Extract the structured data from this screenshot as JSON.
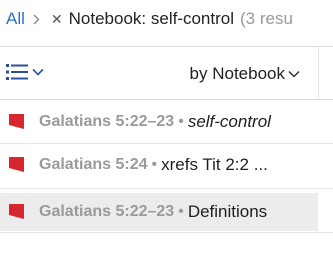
{
  "breadcrumb": {
    "all_label": "All",
    "notebook_title": "Notebook: self-control",
    "result_count": "(3 resu"
  },
  "toolbar": {
    "sort_label": "by Notebook"
  },
  "items": [
    {
      "reference": "Galatians 5:22–23",
      "separator": "•",
      "text": "self-control"
    },
    {
      "reference": "Galatians 5:24",
      "separator": "•",
      "text": "xrefs Tit 2:2 ..."
    },
    {
      "reference": "Galatians 5:22–23",
      "separator": "•",
      "text": "Definitions"
    }
  ],
  "colors": {
    "accent": "#2a6fd1",
    "flag": "#d7262e",
    "selected_row": "#ececec",
    "muted_text": "#9a9a9a"
  },
  "icons": {
    "list_view": "list-view-icon",
    "flag": "flag-icon",
    "chevron": "chevron-down-icon",
    "close": "close-icon"
  }
}
